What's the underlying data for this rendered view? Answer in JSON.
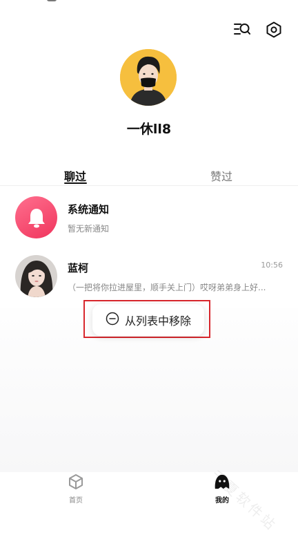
{
  "profile": {
    "nickname": "一休ll8"
  },
  "tabs": {
    "chatted": "聊过",
    "liked": "赞过"
  },
  "chats": [
    {
      "title": "系统通知",
      "subtitle": "暂无新通知",
      "time": ""
    },
    {
      "title": "蓝柯",
      "subtitle": "（一把将你拉进屋里，顺手关上门）哎呀弟弟身上好...",
      "time": "10:56"
    }
  ],
  "context_menu": {
    "remove_label": "从列表中移除"
  },
  "bottom_nav": {
    "home_label": "首页",
    "me_label": "我的"
  },
  "watermark": "千夏软件站",
  "colors": {
    "avatar_bg": "#f6bf3e",
    "notification_accent": "#f0355d",
    "highlight_border": "#d8262c"
  },
  "icons": {
    "top_left": "search-list-icon",
    "top_right": "settings-icon",
    "menu": "minus-circle-icon",
    "home": "cube-icon",
    "me": "ghost-face-icon"
  }
}
